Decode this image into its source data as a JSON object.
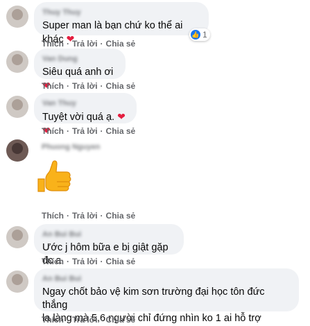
{
  "actions": {
    "like": "Thích",
    "reply": "Trả lời",
    "share": "Chia sẻ"
  },
  "comments": [
    {
      "name": "Thuy Thuy",
      "text": "Super man là bạn chứ ko thể ai khác",
      "emoji": "❤",
      "reaction_count": "1"
    },
    {
      "name": "Van Dung",
      "text": "Siêu quá anh ơi",
      "emoji": "❤"
    },
    {
      "name": "Van Thuy",
      "text": "Tuyệt vời quá ạ.",
      "emoji": "❤❤"
    },
    {
      "name": "Phuong Nguyen",
      "sticker": "thumbs-up"
    },
    {
      "name": "An Bui Bui",
      "text": "Ước j hôm bữa e bị giật gặp đc a"
    },
    {
      "name": "An Bui Bui",
      "text_line1": "Ngay chốt bảo vệ kim sơn trường đại học tôn đức thắng",
      "text_line2": "la làng mà 5,6 người chỉ đứng nhìn ko 1 ai hỗ trợ"
    }
  ]
}
